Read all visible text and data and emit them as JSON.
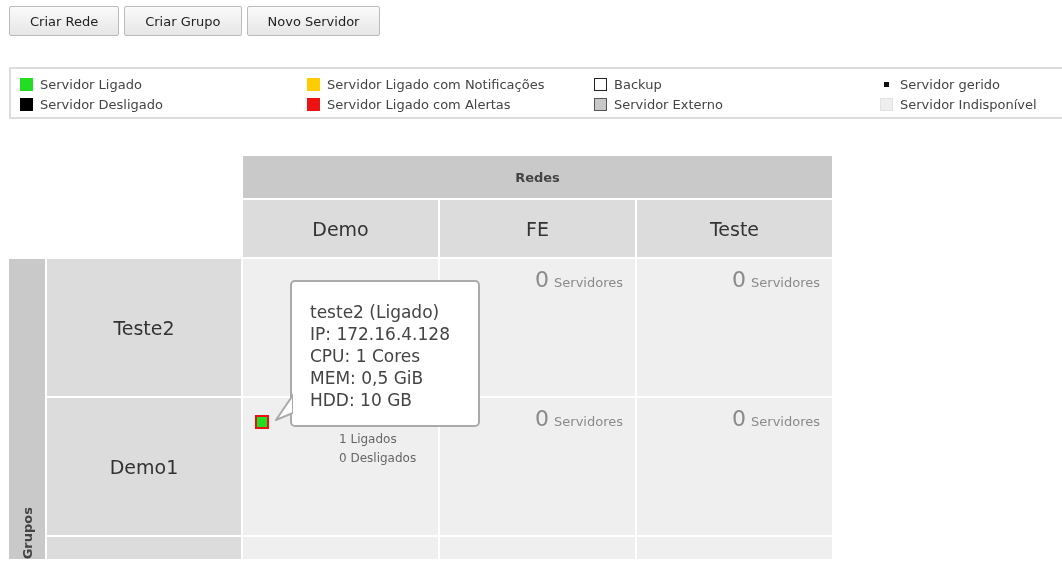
{
  "toolbar": {
    "buttons": [
      "Criar Rede",
      "Criar Grupo",
      "Novo Servidor"
    ]
  },
  "legend": [
    [
      {
        "kind": "swatch",
        "color": "#22dd22",
        "label": "Servidor Ligado"
      },
      {
        "kind": "swatch",
        "color": "#000000",
        "label": "Servidor Desligado"
      }
    ],
    [
      {
        "kind": "swatch",
        "color": "#ffcc00",
        "label": "Servidor Ligado com Notificações"
      },
      {
        "kind": "swatch",
        "color": "#ee1111",
        "label": "Servidor Ligado com Alertas"
      }
    ],
    [
      {
        "kind": "outline",
        "label": "Backup"
      },
      {
        "kind": "external",
        "label": "Servidor Externo"
      }
    ],
    [
      {
        "kind": "dot",
        "label": "Servidor gerido"
      },
      {
        "kind": "faded",
        "label": "Servidor Indisponível"
      }
    ]
  ],
  "grid": {
    "columns_title": "Redes",
    "rows_title": "Grupos",
    "columns": [
      "Demo",
      "FE",
      "Teste"
    ],
    "rows": [
      {
        "name": "Teste2",
        "cells": [
          {
            "kind": "blank"
          },
          {
            "kind": "count",
            "count": "0",
            "label": "Servidores"
          },
          {
            "kind": "count",
            "count": "0",
            "label": "Servidores"
          }
        ]
      },
      {
        "name": "Demo1",
        "cells": [
          {
            "kind": "servers",
            "servers": [
              {
                "color": "#22dd22",
                "alert": true
              }
            ],
            "on": "1 Ligados",
            "off": "0 Desligados",
            "tooltip": [
              "teste2 (Ligado)",
              "IP: 172.16.4.128",
              "CPU: 1 Cores",
              "MEM: 0,5 GiB",
              "HDD: 10 GB"
            ]
          },
          {
            "kind": "count",
            "count": "0",
            "label": "Servidores"
          },
          {
            "kind": "count",
            "count": "0",
            "label": "Servidores"
          }
        ]
      },
      {
        "cells": [
          {
            "kind": "blank"
          },
          {
            "kind": "blank"
          },
          {
            "kind": "blank"
          }
        ]
      }
    ]
  }
}
